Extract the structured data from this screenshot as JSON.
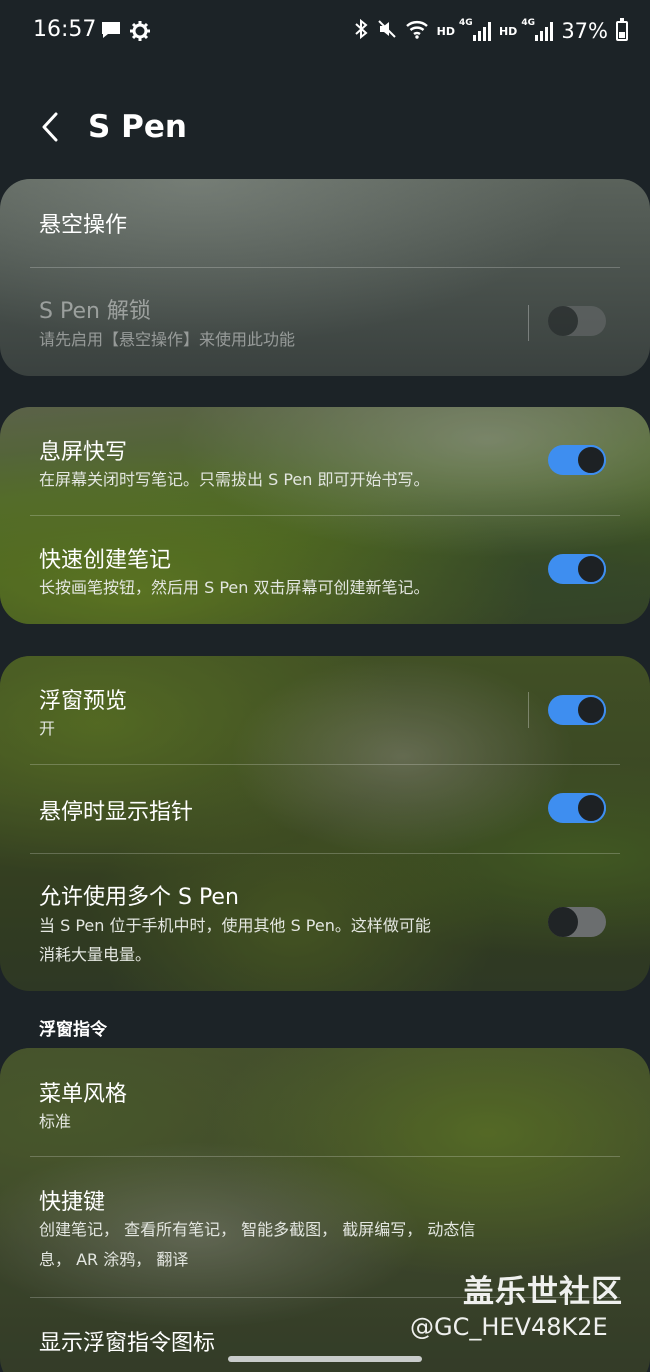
{
  "status_bar": {
    "time": "16:57",
    "hd1": "HD",
    "net1": "4G",
    "hd2": "HD",
    "net2": "4G",
    "battery": "37%"
  },
  "header": {
    "title": "S Pen"
  },
  "hover_card": {
    "air_action": "悬空操作",
    "unlock_title": "S Pen 解锁",
    "unlock_sub": "请先启用【悬空操作】来使用此功能",
    "unlock_state": "off"
  },
  "notes_card": {
    "screen_off_title": "息屏快写",
    "screen_off_sub": "在屏幕关闭时写笔记。只需拔出 S Pen 即可开始书写。",
    "screen_off_state": "on",
    "quick_note_title": "快速创建笔记",
    "quick_note_sub": "长按画笔按钮，然后用 S Pen 双击屏幕可创建新笔记。",
    "quick_note_state": "on"
  },
  "preview_card": {
    "air_view_title": "浮窗预览",
    "air_view_sub": "开",
    "air_view_state": "on",
    "pointer_title": "悬停时显示指针",
    "pointer_state": "on",
    "multi_pen_title": "允许使用多个 S Pen",
    "multi_pen_sub1": "当 S Pen 位于手机中时，使用其他 S Pen。这样做可能",
    "multi_pen_sub2": "消耗大量电量。",
    "multi_pen_state": "off"
  },
  "air_command": {
    "section_title": "浮窗指令",
    "menu_style_title": "菜单风格",
    "menu_style_value": "标准",
    "shortcuts_title": "快捷键",
    "shortcuts_sub1": "创建笔记， 查看所有笔记， 智能多截图， 截屏编写， 动态信",
    "shortcuts_sub2": "息， AR 涂鸦， 翻译",
    "show_icon_title": "显示浮窗指令图标"
  },
  "watermark": {
    "title": "盖乐世社区",
    "id": "@GC_HEV48K2E"
  },
  "colors": {
    "background": "#1c2327",
    "toggle_on": "#3e8ef0",
    "toggle_off": "#6b6e6f"
  },
  "icons": [
    "message-icon",
    "settings-gear-icon",
    "bluetooth-icon",
    "mute-icon",
    "wifi-icon",
    "signal-icon",
    "battery-icon",
    "back-arrow-icon"
  ]
}
